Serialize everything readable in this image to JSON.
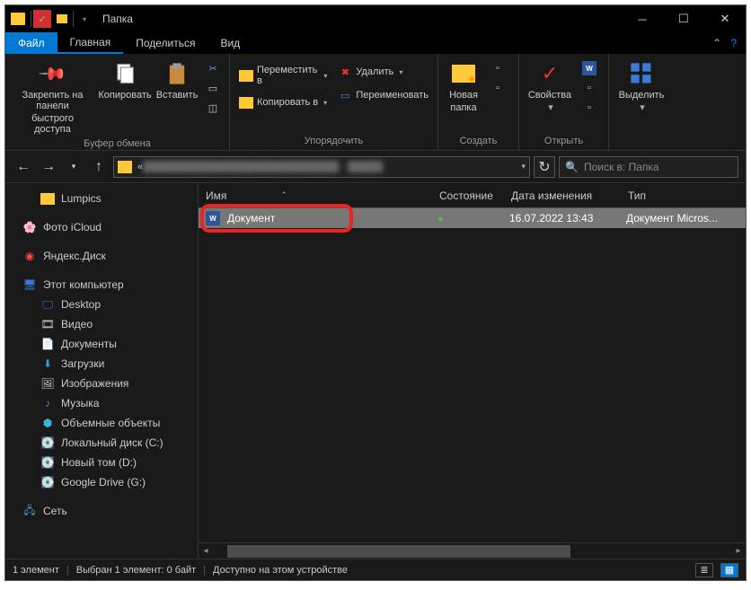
{
  "window": {
    "title": "Папка"
  },
  "tabs": {
    "file": "Файл",
    "home": "Главная",
    "share": "Поделиться",
    "view": "Вид"
  },
  "ribbon": {
    "pin": {
      "label1": "Закрепить на панели",
      "label2": "быстрого доступа"
    },
    "copy": "Копировать",
    "paste": "Вставить",
    "clipboard_group": "Буфер обмена",
    "move_to": "Переместить в",
    "copy_to": "Копировать в",
    "delete": "Удалить",
    "rename": "Переименовать",
    "organize_group": "Упорядочить",
    "new_folder1": "Новая",
    "new_folder2": "папка",
    "create_group": "Создать",
    "properties": "Свойства",
    "open_group": "Открыть",
    "select": "Выделить"
  },
  "search": {
    "placeholder": "Поиск в: Папка"
  },
  "columns": {
    "name": "Имя",
    "state": "Состояние",
    "date": "Дата изменения",
    "type": "Тип"
  },
  "files": [
    {
      "name": "Документ",
      "date": "16.07.2022 13:43",
      "type": "Документ Micros..."
    }
  ],
  "sidebar": {
    "lumpics": "Lumpics",
    "icloud": "Фото iCloud",
    "yadisk": "Яндекс.Диск",
    "thispc": "Этот компьютер",
    "desktop": "Desktop",
    "video": "Видео",
    "documents": "Документы",
    "downloads": "Загрузки",
    "pictures": "Изображения",
    "music": "Музыка",
    "objects3d": "Объемные объекты",
    "diskC": "Локальный диск (C:)",
    "diskD": "Новый том (D:)",
    "diskG": "Google Drive (G:)",
    "network": "Сеть"
  },
  "status": {
    "count": "1 элемент",
    "selection": "Выбран 1 элемент: 0 байт",
    "availability": "Доступно на этом устройстве"
  }
}
